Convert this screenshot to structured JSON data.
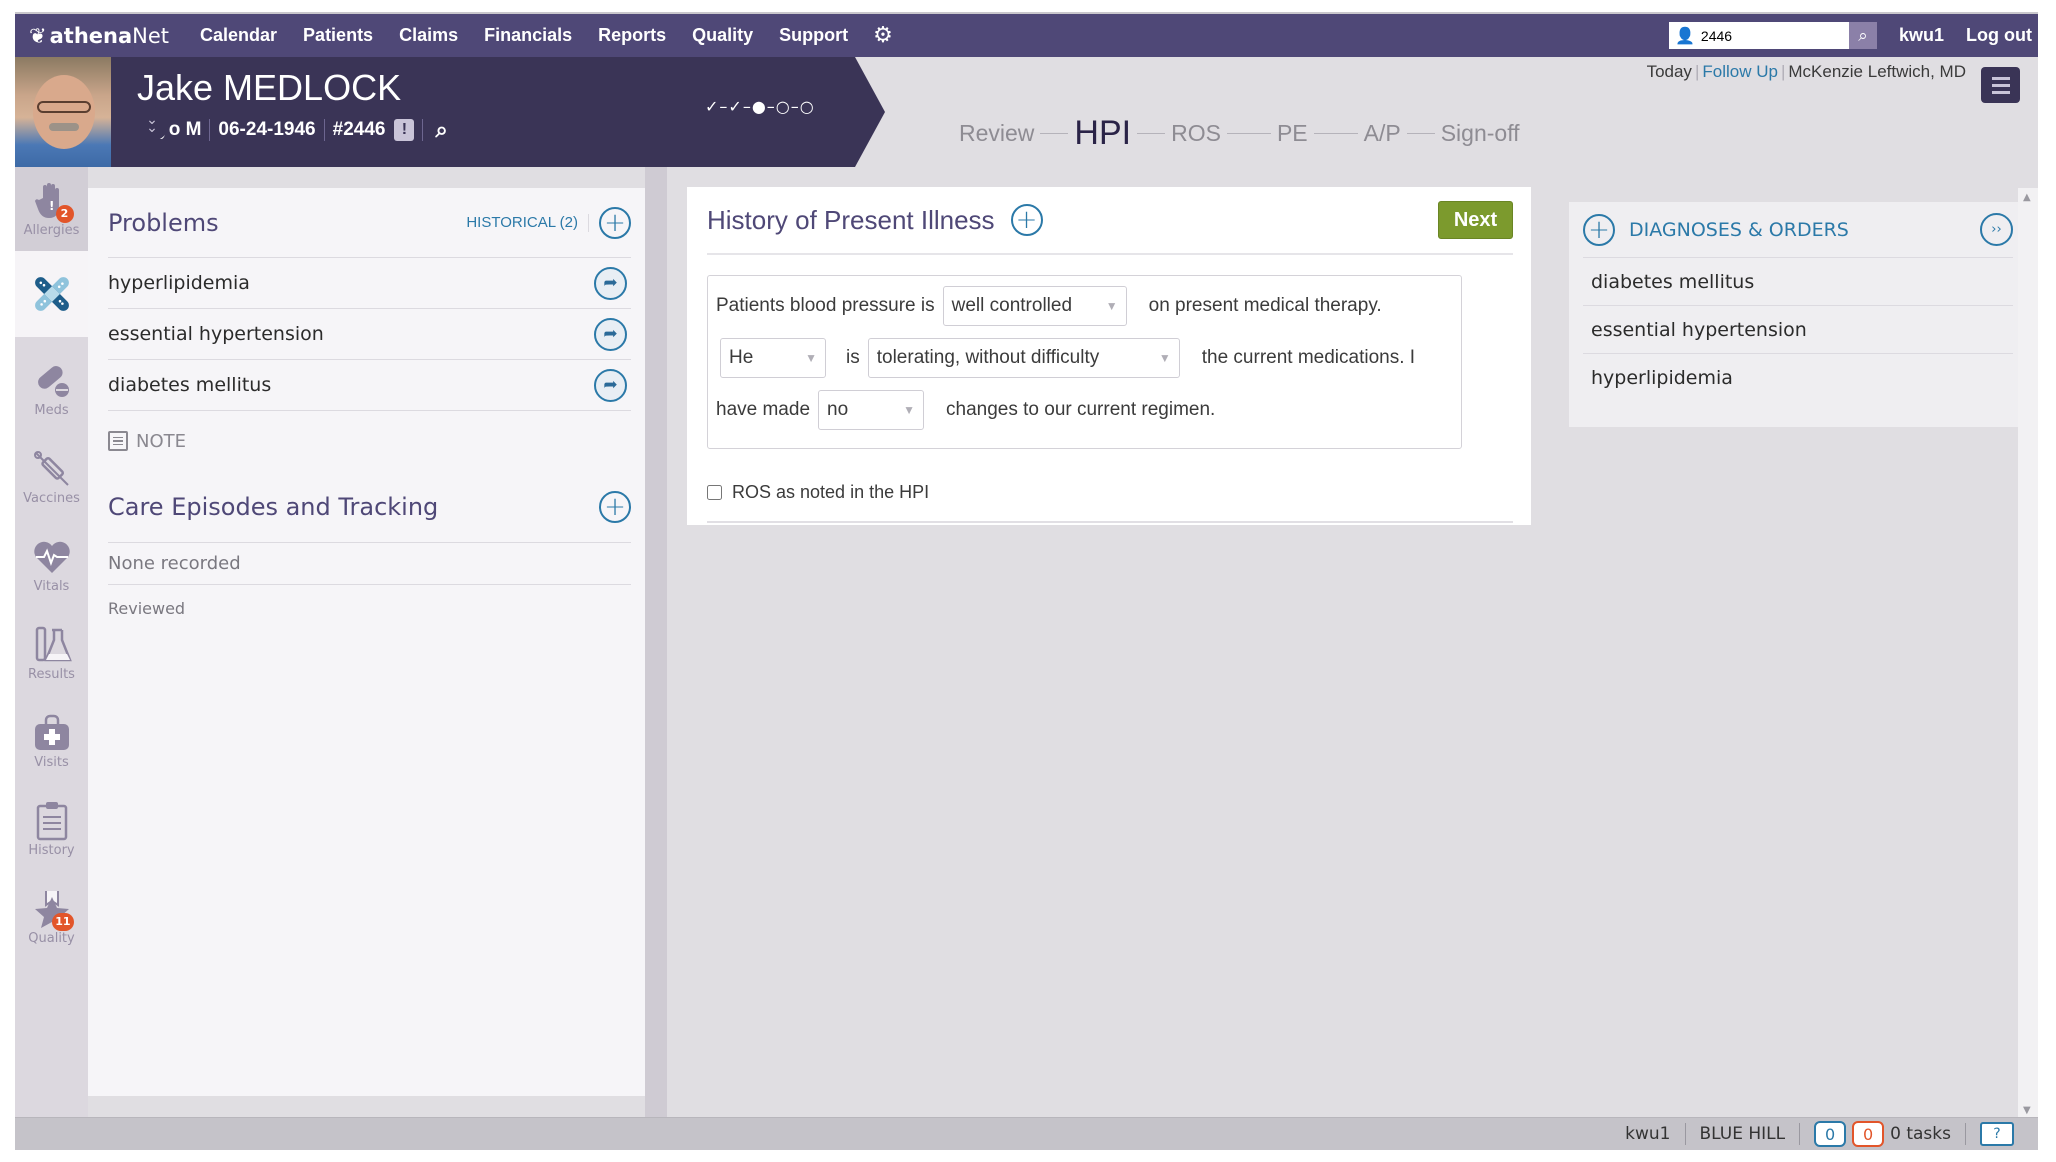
{
  "topnav": {
    "logo_prefix": "athena",
    "logo_suffix": "Net",
    "items": [
      "Calendar",
      "Patients",
      "Claims",
      "Financials",
      "Reports",
      "Quality",
      "Support"
    ],
    "gear_icon": "gear-icon",
    "search_value": "2446",
    "user": "kwu1",
    "logout": "Log out"
  },
  "patient": {
    "name": "Jake MEDLOCK",
    "age_sex": "69yo M",
    "dob": "06-24-1946",
    "id": "#2446",
    "alert_glyph": "!",
    "progress": "✓–✓–●–○–○"
  },
  "workflow": {
    "steps": [
      "Review",
      "HPI",
      "ROS",
      "PE",
      "A/P",
      "Sign-off"
    ],
    "active": "HPI"
  },
  "header_right": {
    "date": "Today",
    "visit_type": "Follow Up",
    "provider": "McKenzie Leftwich, MD"
  },
  "sidebar": {
    "items": [
      {
        "label": "Allergies",
        "badge": "2"
      },
      {
        "label": "",
        "badge": ""
      },
      {
        "label": "Meds",
        "badge": ""
      },
      {
        "label": "Vaccines",
        "badge": ""
      },
      {
        "label": "Vitals",
        "badge": ""
      },
      {
        "label": "Results",
        "badge": ""
      },
      {
        "label": "Visits",
        "badge": ""
      },
      {
        "label": "History",
        "badge": ""
      },
      {
        "label": "Quality",
        "badge": "11"
      }
    ]
  },
  "problems": {
    "title": "Problems",
    "historical": "HISTORICAL (2)",
    "items": [
      "hyperlipidemia",
      "essential hypertension",
      "diabetes mellitus"
    ],
    "note_label": "NOTE"
  },
  "care": {
    "title": "Care Episodes and Tracking",
    "empty": "None recorded",
    "reviewed": "Reviewed"
  },
  "hpi": {
    "title": "History of Present Illness",
    "next": "Next",
    "line1_pre": "Patients blood pressure is",
    "line1_select": "well controlled",
    "line1_post": "on present medical therapy.",
    "line2_select_a": "He",
    "line2_mid": "is",
    "line2_select_b": "tolerating, without difficulty",
    "line2_post": "the current medications. I",
    "line3_pre": "have made",
    "line3_select": "no",
    "line3_post": "changes to our current regimen.",
    "ros_checkbox_label": "ROS as noted in the HPI",
    "ros_checked": false
  },
  "diagnoses": {
    "title": "DIAGNOSES & ORDERS",
    "items": [
      "diabetes mellitus",
      "essential hypertension",
      "hyperlipidemia"
    ]
  },
  "statusbar": {
    "user": "kwu1",
    "location": "BLUE HILL",
    "count_blue": "0",
    "count_orange": "0",
    "tasks": "0 tasks",
    "help": "?"
  },
  "colors": {
    "nav_bg": "#4f4877",
    "banner_bg": "#3a3456",
    "accent_blue": "#2b79a8",
    "next_green": "#7c9a2d",
    "badge_orange": "#e2552a"
  }
}
